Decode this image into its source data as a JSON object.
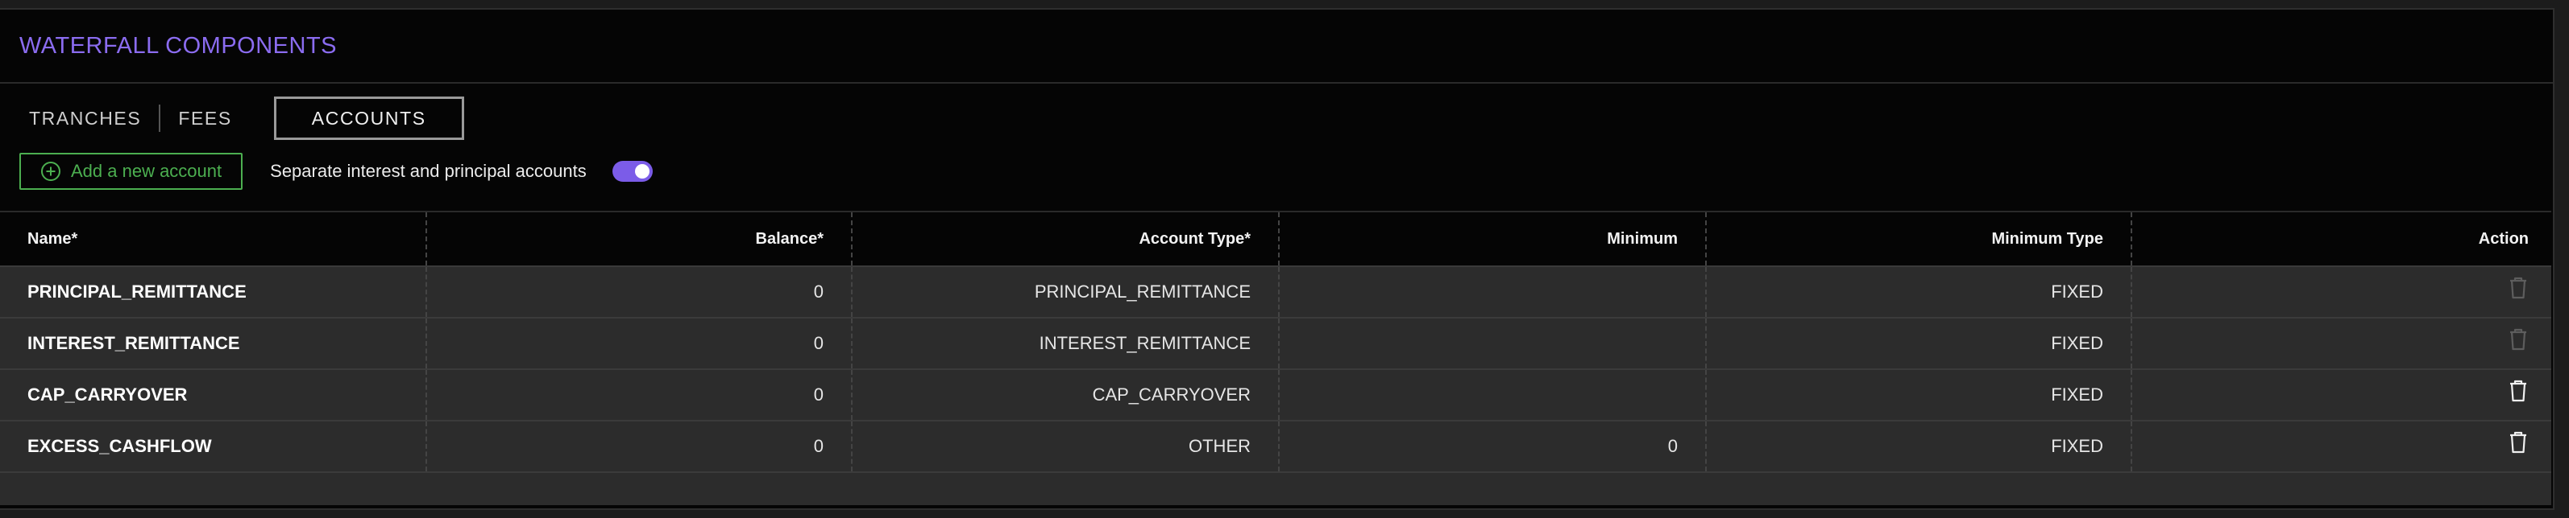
{
  "header": {
    "title": "WATERFALL COMPONENTS"
  },
  "tabs": [
    {
      "label": "TRANCHES",
      "active": false
    },
    {
      "label": "FEES",
      "active": false
    },
    {
      "label": "ACCOUNTS",
      "active": true
    }
  ],
  "toolbar": {
    "add_button_label": "Add a new account",
    "add_button_icon": "plus-circle-icon",
    "separate_label": "Separate interest and principal accounts",
    "separate_toggle_on": true
  },
  "table": {
    "columns": [
      "Name*",
      "Balance*",
      "Account Type*",
      "Minimum",
      "Minimum Type",
      "Action"
    ],
    "rows": [
      {
        "name": "PRINCIPAL_REMITTANCE",
        "balance": "0",
        "account_type": "PRINCIPAL_REMITTANCE",
        "minimum": "",
        "minimum_type": "FIXED",
        "delete_enabled": false
      },
      {
        "name": "INTEREST_REMITTANCE",
        "balance": "0",
        "account_type": "INTEREST_REMITTANCE",
        "minimum": "",
        "minimum_type": "FIXED",
        "delete_enabled": false
      },
      {
        "name": "CAP_CARRYOVER",
        "balance": "0",
        "account_type": "CAP_CARRYOVER",
        "minimum": "",
        "minimum_type": "FIXED",
        "delete_enabled": true
      },
      {
        "name": "EXCESS_CASHFLOW",
        "balance": "0",
        "account_type": "OTHER",
        "minimum": "0",
        "minimum_type": "FIXED",
        "delete_enabled": true
      }
    ]
  },
  "colors": {
    "accent": "#8b6cf0",
    "add_button": "#4caf50",
    "toggle": "#7b5ce8"
  }
}
